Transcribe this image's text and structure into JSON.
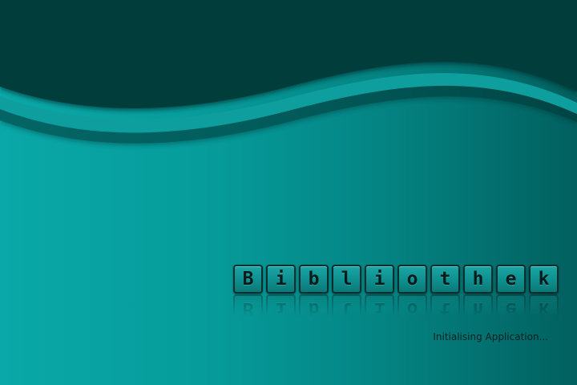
{
  "app": {
    "title_letters": [
      "B",
      "i",
      "b",
      "l",
      "i",
      "o",
      "t",
      "h",
      "e",
      "k"
    ]
  },
  "status": {
    "message": "Initialising Application..."
  },
  "colors": {
    "background_light": "#0aa8a8",
    "background_dark": "#02605f",
    "header_band": "#043c3b",
    "wave_stripe": "#0e9e9d",
    "tile_border": "#0b2f2f",
    "text_dark": "#0a2020"
  }
}
